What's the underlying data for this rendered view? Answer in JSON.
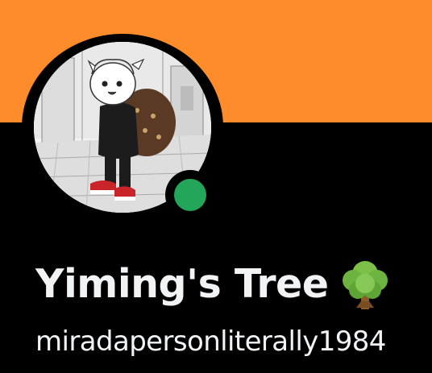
{
  "profile": {
    "display_name": "Yiming's Tree",
    "username": "miradapersonliterally1984",
    "name_emoji": "deciduous-tree-icon",
    "status": "online"
  },
  "colors": {
    "banner": "#ff8c2a",
    "background": "#000000",
    "status_online": "#23a55a",
    "text": "#f2f3f5"
  }
}
